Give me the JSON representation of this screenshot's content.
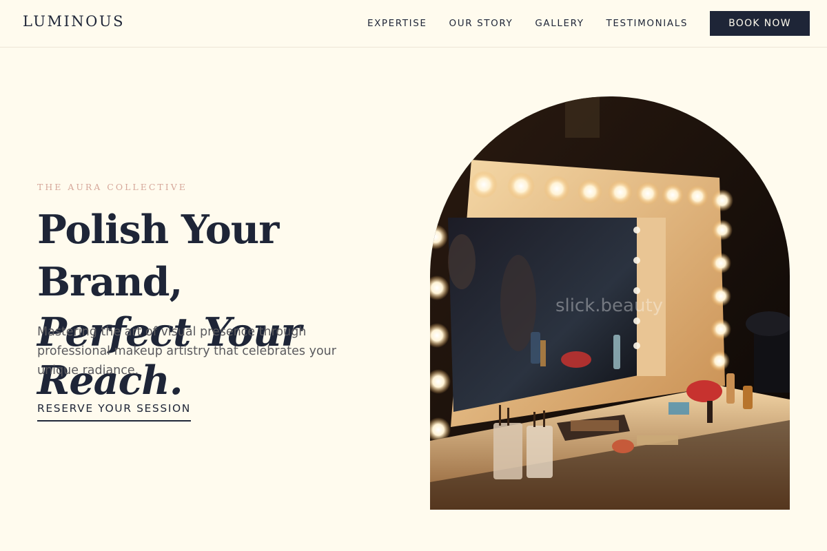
{
  "header": {
    "logo": "LUMINOUS",
    "nav": [
      "EXPERTISE",
      "OUR STORY",
      "GALLERY",
      "TESTIMONIALS"
    ],
    "book_label": "BOOK NOW"
  },
  "hero": {
    "eyebrow": "THE AURA COLLECTIVE",
    "headline_line1": "Polish Your Brand,",
    "headline_line2": "Perfect Your Reach.",
    "subtitle": "Mastering the art of visual presence through professional makeup artistry that celebrates your unique radiance.",
    "cta_label": "RESERVE YOUR SESSION",
    "image_watermark": "slick.beauty"
  },
  "colors": {
    "background": "#fffbee",
    "navy": "#1e2537",
    "accent": "#d6a79a"
  }
}
